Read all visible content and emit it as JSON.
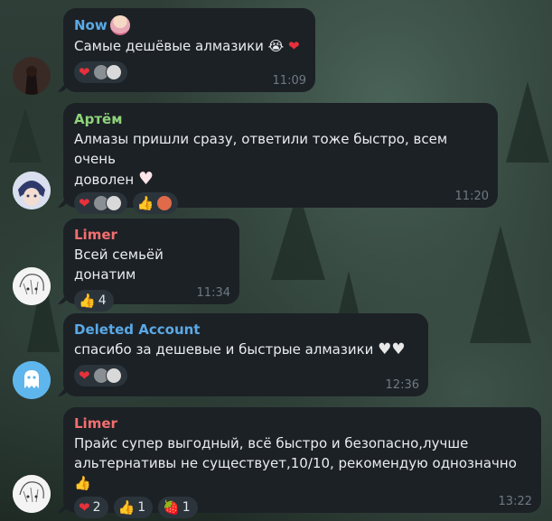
{
  "messages": [
    {
      "author": "Now",
      "author_color": "#5aa9e6",
      "text": "Самые дешёвые алмазики",
      "time": "11:09",
      "reactions": [
        "heart",
        "avatars"
      ]
    },
    {
      "author": "Артём",
      "author_color": "#8fd37a",
      "text_line1": "Алмазы пришли сразу, ответили тоже быстро, всем очень",
      "text_line2": "доволен",
      "time": "11:20",
      "reactions": [
        "heart",
        "avatars",
        "thumbs-up",
        "ghost-avatar"
      ]
    },
    {
      "author": "Limer",
      "author_color": "#f36f6f",
      "text": "Всей семьёй донатим",
      "time": "11:34",
      "reaction_count": "4"
    },
    {
      "author": "Deleted Account",
      "author_color": "#5aa9e6",
      "text": "спасибо за дешевые и быстрые алмазики",
      "time": "12:36"
    },
    {
      "author": "Limer",
      "author_color": "#f36f6f",
      "text_line1": "Прайс супер выгодный, всё быстро и безопасно,лучше",
      "text_line2": "альтернативы не существует,10/10, рекомендую однозначно",
      "time": "13:22",
      "reaction_counts": {
        "heart": "2",
        "thumbs": "1",
        "strawberry": "1"
      }
    }
  ]
}
